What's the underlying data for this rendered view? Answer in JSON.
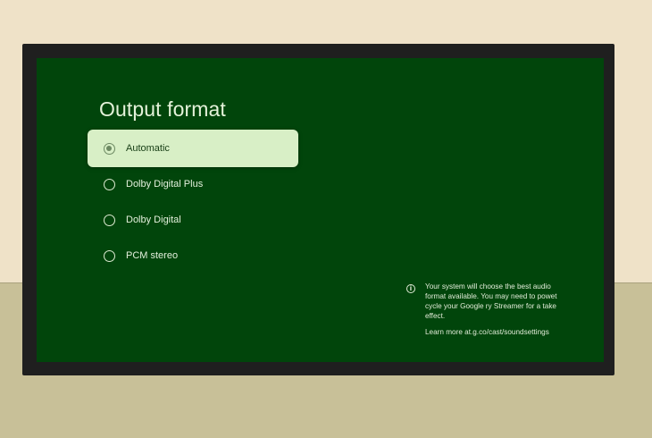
{
  "screen": {
    "title": "Output format",
    "options": [
      {
        "label": "Automatic",
        "selected": true,
        "focused": true
      },
      {
        "label": "Dolby Digital Plus",
        "selected": false,
        "focused": false
      },
      {
        "label": "Dolby Digital",
        "selected": false,
        "focused": false
      },
      {
        "label": "PCM stereo",
        "selected": false,
        "focused": false
      }
    ],
    "info": {
      "icon": "info-icon",
      "text": "Your system will choose the best audio format available. You may need to powet cycle your Google ry Streamer for a take effect.",
      "link_text": "Learn more at.g.co/cast/soundsettings"
    }
  },
  "colors": {
    "screen_background": "#01450b",
    "focused_option": "#d8efc6",
    "bezel": "#1f1f1f"
  }
}
